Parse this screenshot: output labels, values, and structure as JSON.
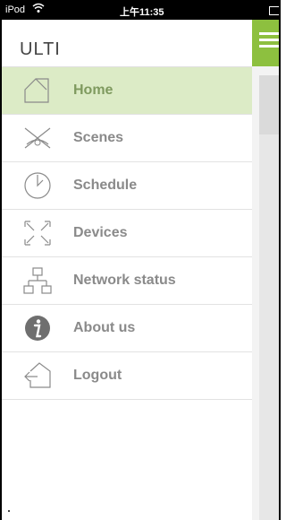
{
  "status_bar": {
    "carrier": "iPod",
    "time": "上午11:35"
  },
  "app": {
    "title": "ULTI"
  },
  "menu": {
    "items": [
      {
        "label": "Home",
        "icon": "home-icon",
        "active": true
      },
      {
        "label": "Scenes",
        "icon": "scenes-icon",
        "active": false
      },
      {
        "label": "Schedule",
        "icon": "clock-icon",
        "active": false
      },
      {
        "label": "Devices",
        "icon": "devices-icon",
        "active": false
      },
      {
        "label": "Network status",
        "icon": "network-icon",
        "active": false
      },
      {
        "label": "About us",
        "icon": "info-icon",
        "active": false
      },
      {
        "label": "Logout",
        "icon": "logout-icon",
        "active": false
      }
    ]
  },
  "colors": {
    "accent": "#8dc03f",
    "active_bg": "#dcebc6",
    "label": "#8a8a8a"
  }
}
